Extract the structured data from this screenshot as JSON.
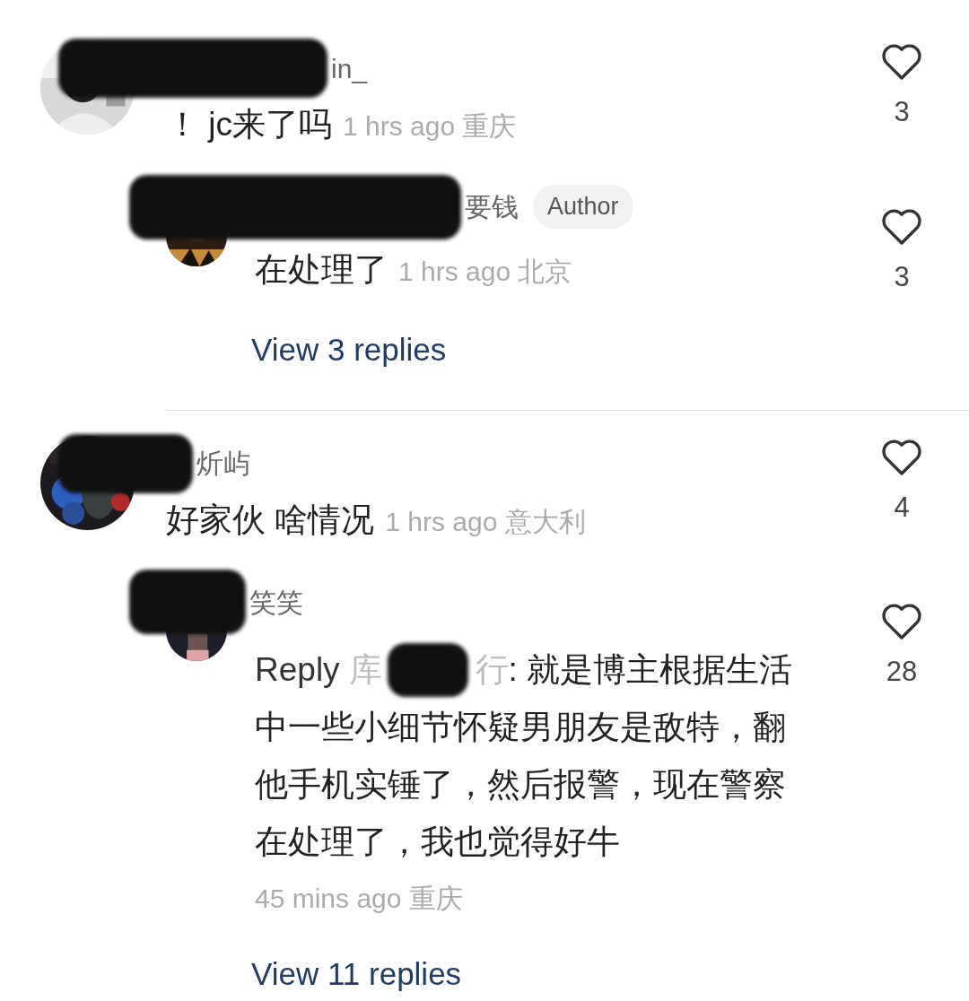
{
  "comments": [
    {
      "name_visible": "in_",
      "text": "！ jc来了吗",
      "time": "1 hrs ago",
      "location": "重庆",
      "likes": "3",
      "view_replies": "View 3 replies",
      "replies": [
        {
          "name_visible": "要钱",
          "badge": "Author",
          "text": "在处理了",
          "time": "1 hrs ago",
          "location": "北京",
          "likes": "3"
        }
      ]
    },
    {
      "name_visible": "炘屿",
      "text": "好家伙 啥情况",
      "time": "1 hrs ago",
      "location": "意大利",
      "likes": "4",
      "view_replies": "View 11 replies",
      "replies": [
        {
          "name_visible": "笑笑",
          "reply_label": "Reply",
          "reply_to_start": "库",
          "reply_to_end": "行",
          "text": [
            ": 就是博主根据生活",
            "中一些小细节怀疑男朋友是敌特，翻他手机实锤了，然后报警，现在警察在处理了，我也觉得好牛"
          ],
          "time": "45 mins ago",
          "location": "重庆",
          "likes": "28"
        }
      ]
    }
  ]
}
